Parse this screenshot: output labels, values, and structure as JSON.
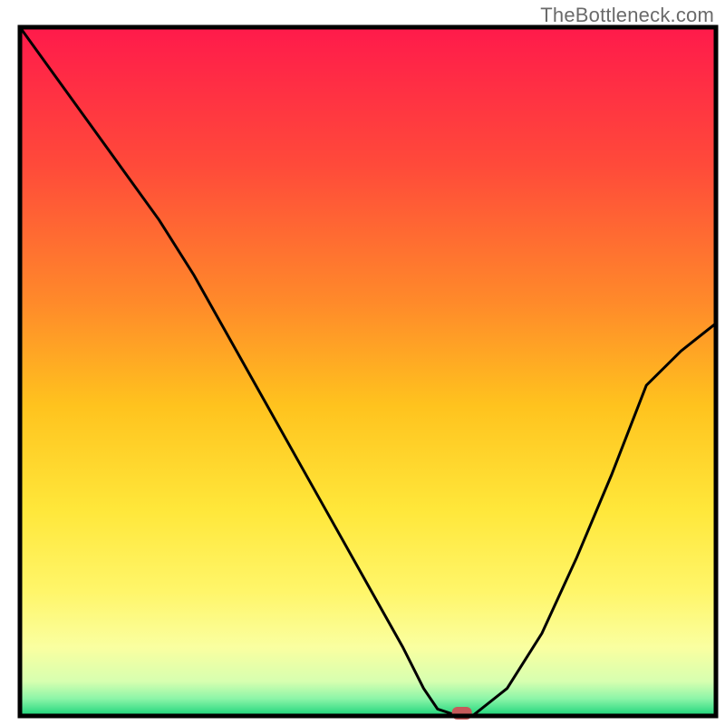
{
  "watermark": "TheBottleneck.com",
  "chart_data": {
    "type": "line",
    "title": "",
    "xlabel": "",
    "ylabel": "",
    "xlim": [
      0,
      100
    ],
    "ylim": [
      0,
      100
    ],
    "x": [
      0,
      5,
      10,
      15,
      20,
      25,
      30,
      35,
      40,
      45,
      50,
      55,
      58,
      60,
      63,
      65,
      70,
      75,
      80,
      85,
      90,
      95,
      100
    ],
    "values": [
      100,
      93,
      86,
      79,
      72,
      64,
      55,
      46,
      37,
      28,
      19,
      10,
      4,
      1,
      0,
      0,
      4,
      12,
      23,
      35,
      48,
      53,
      57
    ],
    "marker": {
      "x": 63.5,
      "y": 0
    },
    "gradient_stops": [
      {
        "offset": 0.0,
        "color": "#ff1a4b"
      },
      {
        "offset": 0.2,
        "color": "#ff4a3a"
      },
      {
        "offset": 0.4,
        "color": "#ff8a2a"
      },
      {
        "offset": 0.55,
        "color": "#ffc31e"
      },
      {
        "offset": 0.7,
        "color": "#ffe73a"
      },
      {
        "offset": 0.82,
        "color": "#fff66a"
      },
      {
        "offset": 0.9,
        "color": "#faffa0"
      },
      {
        "offset": 0.95,
        "color": "#d7ffb0"
      },
      {
        "offset": 0.975,
        "color": "#8cf5a8"
      },
      {
        "offset": 1.0,
        "color": "#1ad47a"
      }
    ],
    "frame_color": "#000000",
    "line_color": "#000000",
    "marker_color": "#c65a5a"
  }
}
